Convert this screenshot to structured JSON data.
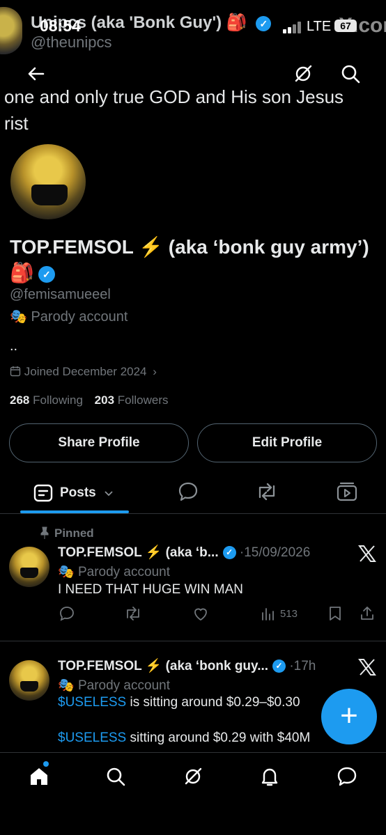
{
  "status_bar": {
    "time": "08:54",
    "network": "LTE",
    "battery": "67"
  },
  "overlay_header": {
    "name": "Unipcs (aka 'Bonk Guy')",
    "name_emoji": "🎒",
    "handle": "@theunipcs",
    "watermark": "X.com"
  },
  "nav": {
    "back_icon": "arrow-left-icon",
    "grok_icon": "grok-icon",
    "search_icon": "search-icon"
  },
  "bio_banner": {
    "line1": "one and only true GOD and His son Jesus",
    "line2": "rist"
  },
  "profile": {
    "display_name": "TOP.FEMSOL ⚡️ (aka ‘bonk guy army’)",
    "name_emoji": "🎒",
    "handle": "@femisamueeel",
    "parody_label": "Parody account",
    "parody_emoji": "🎭",
    "bio": "..",
    "joined": "Joined December 2024",
    "following_count": "268",
    "following_label": "Following",
    "followers_count": "203",
    "followers_label": "Followers"
  },
  "buttons": {
    "share_profile": "Share Profile",
    "edit_profile": "Edit Profile"
  },
  "tabs": {
    "posts_label": "Posts",
    "icons": [
      "posts-icon",
      "replies-icon",
      "reposts-icon",
      "media-icon"
    ]
  },
  "tweets": [
    {
      "pinned_label": "Pinned",
      "author": "TOP.FEMSOL ⚡️ (aka ‘b...",
      "separator": "·",
      "date": "15/09/2026",
      "parody_label": "Parody account",
      "text": "I NEED THAT HUGE WIN MAN",
      "views": "513"
    },
    {
      "author": "TOP.FEMSOL ⚡️ (aka ‘bonk guy...",
      "separator": "·",
      "date": "17h",
      "parody_label": "Parody account",
      "text_line1_cashtag": "$USELESS",
      "text_line1_rest": " is sitting around $0.29–$0.30",
      "text_line2_cashtag": "$USELESS",
      "text_line2_rest": " sitting around $0.29 with $40M"
    }
  ],
  "fab_label": "+",
  "bottom_nav": [
    "home-icon",
    "search-icon",
    "grok-icon",
    "notifications-icon",
    "messages-icon"
  ],
  "colors": {
    "background": "#000000",
    "accent": "#1d9bf0",
    "muted": "#71767b",
    "text": "#e7e9ea",
    "border": "#2f3336"
  }
}
